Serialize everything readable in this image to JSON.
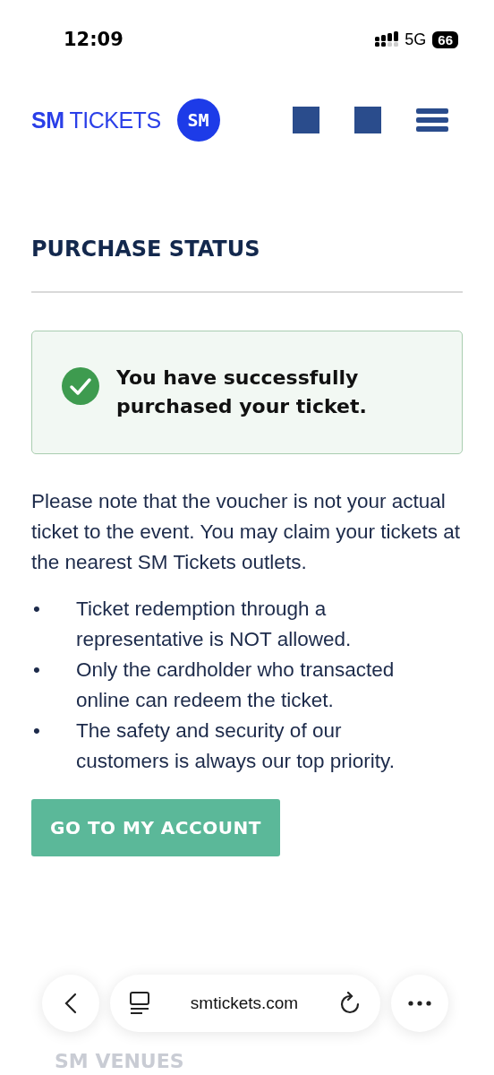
{
  "status_bar": {
    "time": "12:09",
    "network": "5G",
    "battery": "66"
  },
  "header": {
    "brand_bold": "SM",
    "brand_light": "TICKETS",
    "logo_badge": "SM"
  },
  "title": "PURCHASE STATUS",
  "alert": {
    "kind": "success",
    "message": "You have successfully purchased your ticket."
  },
  "note": "Please note that the voucher is not your actual ticket to the event. You may claim your tickets at the nearest SM Tickets outlets.",
  "bullets": [
    {
      "marker": "•",
      "text": "Ticket redemption through a representative is NOT allowed."
    },
    {
      "marker": "•",
      "text": "Only the cardholder who transacted online can redeem the ticket."
    },
    {
      "marker": "•",
      "text": "The safety and security of our customers is always our top priority."
    }
  ],
  "button": "GO TO MY ACCOUNT",
  "footer_heading": "SM VENUES",
  "browser": {
    "url": "smtickets.com"
  }
}
